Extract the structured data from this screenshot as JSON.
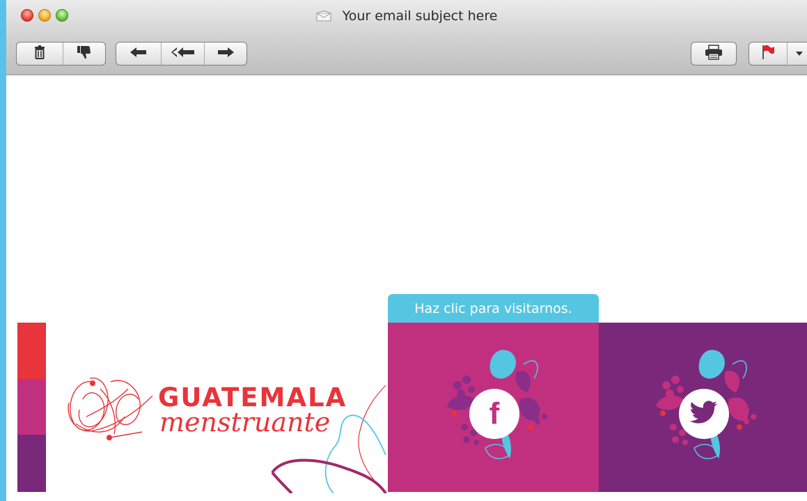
{
  "window": {
    "title": "Your email subject here"
  },
  "toolbar": {
    "left_group_1": [
      {
        "name": "trash-icon",
        "action": "Delete"
      },
      {
        "name": "thumbs-down-icon",
        "action": "Junk"
      }
    ],
    "left_group_2": [
      {
        "name": "reply-icon",
        "action": "Reply"
      },
      {
        "name": "reply-all-icon",
        "action": "Reply All"
      },
      {
        "name": "forward-icon",
        "action": "Forward"
      }
    ],
    "right_group": [
      {
        "name": "printer-icon",
        "action": "Print"
      },
      {
        "name": "flag-icon",
        "action": "Flag"
      }
    ]
  },
  "email": {
    "brand": {
      "line1": "GUATEMALA",
      "line2": "menstruante"
    },
    "cta_tab": "Haz clic para visitarnos.",
    "social": [
      {
        "name": "facebook",
        "icon": "facebook-icon"
      },
      {
        "name": "twitter",
        "icon": "twitter-bird-icon"
      }
    ],
    "colors": {
      "red": "#e8343b",
      "magenta": "#c1307f",
      "purple": "#7a287a",
      "cyan": "#55c6e2"
    }
  }
}
